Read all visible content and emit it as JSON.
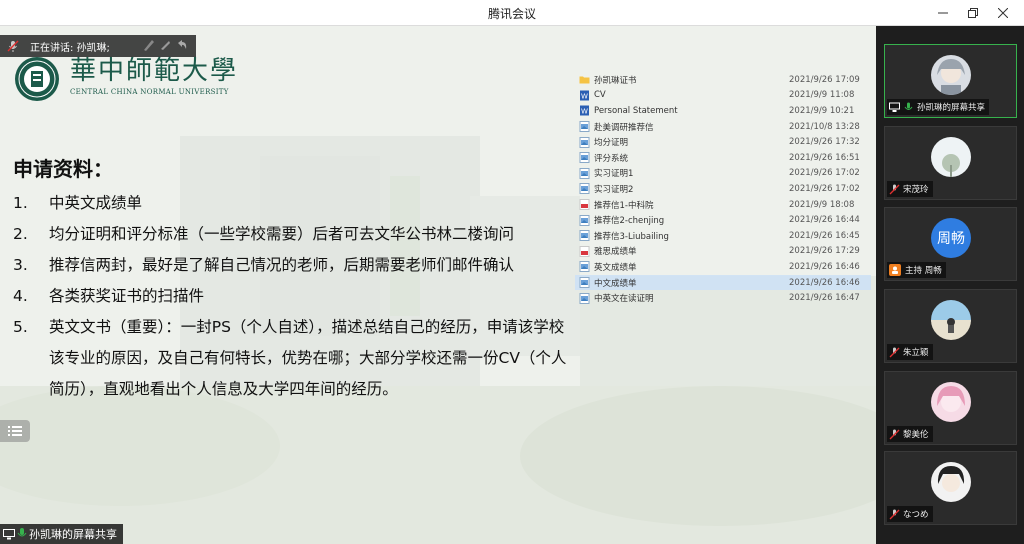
{
  "window": {
    "title": "腾讯会议",
    "buttons": [
      "minimize",
      "restore",
      "close"
    ]
  },
  "speaking": {
    "label": "正在讲话: 孙凯琳;"
  },
  "slide": {
    "logo_cn": "華中師範大學",
    "logo_en": "CENTRAL CHINA NORMAL UNIVERSITY",
    "heading": "申请资料：",
    "items": [
      {
        "num": "1.",
        "text": "中英文成绩单"
      },
      {
        "num": "2.",
        "text": "均分证明和评分标准（一些学校需要）后者可去文华公书林二楼询问"
      },
      {
        "num": "3.",
        "text": "推荐信两封，最好是了解自己情况的老师，后期需要老师们邮件确认"
      },
      {
        "num": "4.",
        "text": "各类获奖证书的扫描件"
      },
      {
        "num": "5.",
        "text": "英文文书（重要）：一封PS（个人自述），描述总结自己的经历，申请该学校该专业的原因，及自己有何特长，优势在哪；大部分学校还需一份CV（个人简历），直观地看出个人信息及大学四年间的经历。"
      }
    ],
    "files": [
      {
        "name": "孙凯琳证书",
        "date": "2021/9/26 17:09",
        "icon": "folder"
      },
      {
        "name": "CV",
        "date": "2021/9/9 11:08",
        "icon": "word"
      },
      {
        "name": "Personal Statement",
        "date": "2021/9/9 10:21",
        "icon": "word"
      },
      {
        "name": "赴美调研推荐信",
        "date": "2021/10/8 13:28",
        "icon": "image"
      },
      {
        "name": "均分证明",
        "date": "2021/9/26 17:32",
        "icon": "image"
      },
      {
        "name": "评分系统",
        "date": "2021/9/26 16:51",
        "icon": "image"
      },
      {
        "name": "实习证明1",
        "date": "2021/9/26 17:02",
        "icon": "image"
      },
      {
        "name": "实习证明2",
        "date": "2021/9/26 17:02",
        "icon": "image"
      },
      {
        "name": "推荐信1-中科院",
        "date": "2021/9/9 18:08",
        "icon": "pdf"
      },
      {
        "name": "推荐信2-chenjing",
        "date": "2021/9/26 16:44",
        "icon": "image"
      },
      {
        "name": "推荐信3-Liubailing",
        "date": "2021/9/26 16:45",
        "icon": "image"
      },
      {
        "name": "雅思成绩单",
        "date": "2021/9/26 17:29",
        "icon": "pdf"
      },
      {
        "name": "英文成绩单",
        "date": "2021/9/26 16:46",
        "icon": "image"
      },
      {
        "name": "中文成绩单",
        "date": "2021/9/26 16:46",
        "icon": "image",
        "selected": true
      },
      {
        "name": "中英文在读证明",
        "date": "2021/9/26 16:47",
        "icon": "image"
      }
    ]
  },
  "share_bar": {
    "label": "孙凯琳的屏幕共享"
  },
  "participants": [
    {
      "name": "孙凯琳的屏幕共享",
      "avatar": "anime-gray",
      "status": "sharing",
      "active": true
    },
    {
      "name": "宋茂玲",
      "avatar": "sky-tree",
      "status": "muted"
    },
    {
      "name": "主持 周畅",
      "avatar_text": "周畅",
      "status": "host"
    },
    {
      "name": "朱立颖",
      "avatar": "beach",
      "status": "muted"
    },
    {
      "name": "黎美伦",
      "avatar": "anime-pink",
      "status": "muted"
    },
    {
      "name": "なつめ",
      "avatar": "anime-dark",
      "status": "muted"
    }
  ],
  "colors": {
    "accent_green": "#37b24d",
    "host_orange": "#f07f20",
    "avatar_blue": "#2f7de1",
    "logo_green": "#1c5a4a"
  }
}
